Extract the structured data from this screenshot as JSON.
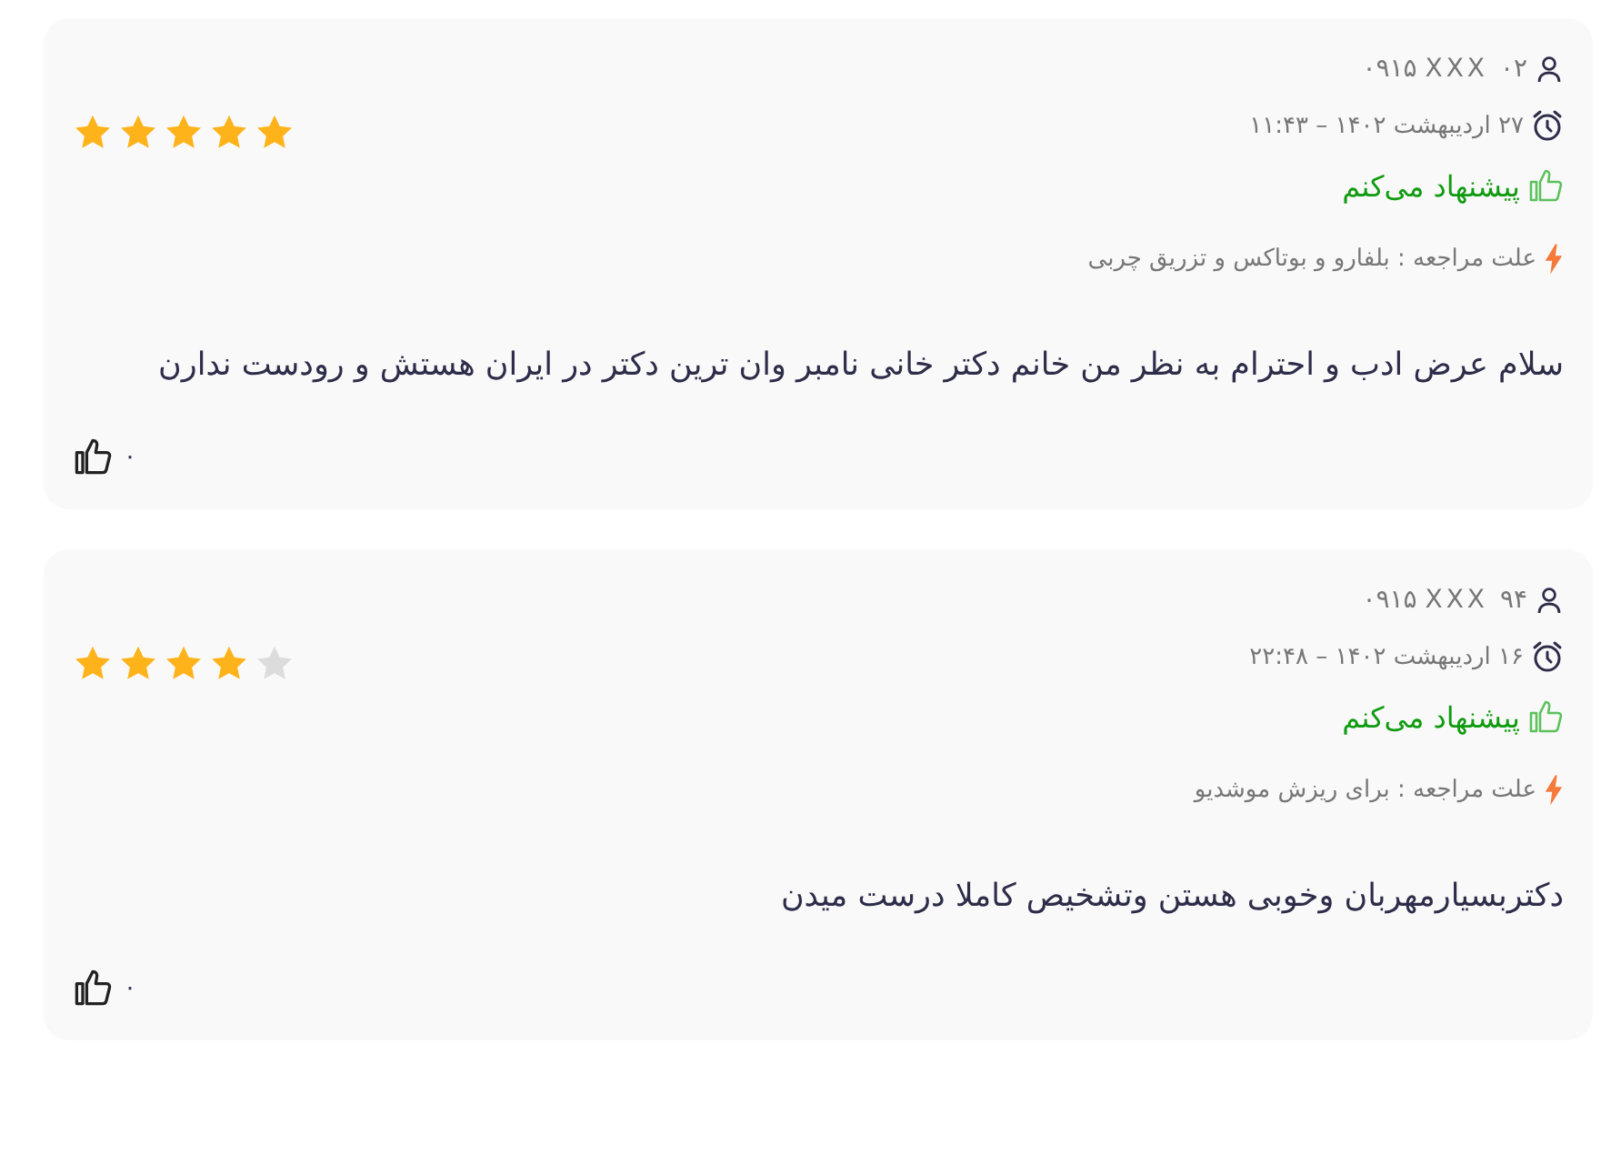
{
  "reviews": [
    {
      "user": "۰۹۱۵ XXX ۰۲",
      "date": "۲۷ اردیبهشت ۱۴۰۲ – ۱۱:۴۳",
      "recommend": "پیشنهاد می‌کنم",
      "reason": "علت مراجعه : بلفارو و بوتاکس و تزریق چربی",
      "stars": 5,
      "text": "سلام عرض ادب و احترام به نظر من خانم دکتر خانی نامبر وان ترین دکتر در ایران هستش و رودست ندارن",
      "likes": "۰"
    },
    {
      "user": "۰۹۱۵ XXX ۹۴",
      "date": "۱۶ اردیبهشت ۱۴۰۲ – ۲۲:۴۸",
      "recommend": "پیشنهاد می‌کنم",
      "reason": "علت مراجعه : برای ریزش موشدیو",
      "stars": 4,
      "text": "دکتربسیارمهربان وخوبی هستن وتشخیص کاملا درست میدن",
      "likes": "۰"
    }
  ]
}
